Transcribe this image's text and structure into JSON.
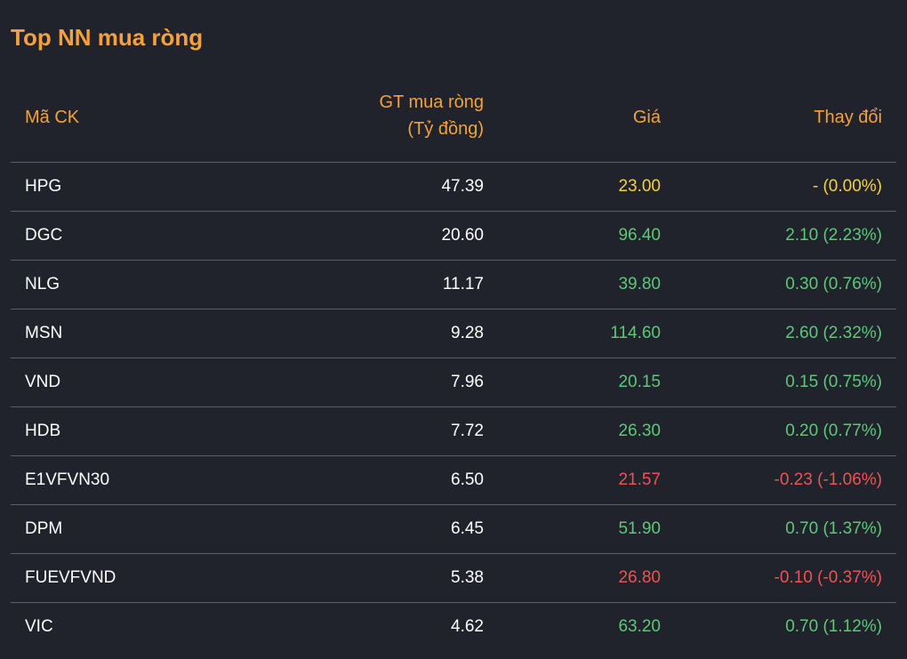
{
  "title": "Top NN mua ròng",
  "columns": {
    "code": "Mã CK",
    "value_line1": "GT mua ròng",
    "value_line2": "(Tỷ đồng)",
    "price": "Giá",
    "change": "Thay đổi"
  },
  "colors": {
    "accent": "#f4a13b",
    "up": "#5ec878",
    "down": "#ef5350",
    "reference": "#f5d142",
    "background": "#20232b"
  },
  "rows": [
    {
      "code": "HPG",
      "value": "47.39",
      "price": "23.00",
      "change": "- (0.00%)",
      "trend": "ref"
    },
    {
      "code": "DGC",
      "value": "20.60",
      "price": "96.40",
      "change": "2.10 (2.23%)",
      "trend": "up"
    },
    {
      "code": "NLG",
      "value": "11.17",
      "price": "39.80",
      "change": "0.30 (0.76%)",
      "trend": "up"
    },
    {
      "code": "MSN",
      "value": "9.28",
      "price": "114.60",
      "change": "2.60 (2.32%)",
      "trend": "up"
    },
    {
      "code": "VND",
      "value": "7.96",
      "price": "20.15",
      "change": "0.15 (0.75%)",
      "trend": "up"
    },
    {
      "code": "HDB",
      "value": "7.72",
      "price": "26.30",
      "change": "0.20 (0.77%)",
      "trend": "up"
    },
    {
      "code": "E1VFVN30",
      "value": "6.50",
      "price": "21.57",
      "change": "-0.23 (-1.06%)",
      "trend": "down"
    },
    {
      "code": "DPM",
      "value": "6.45",
      "price": "51.90",
      "change": "0.70 (1.37%)",
      "trend": "up"
    },
    {
      "code": "FUEVFVND",
      "value": "5.38",
      "price": "26.80",
      "change": "-0.10 (-0.37%)",
      "trend": "down"
    },
    {
      "code": "VIC",
      "value": "4.62",
      "price": "63.20",
      "change": "0.70 (1.12%)",
      "trend": "up"
    }
  ]
}
